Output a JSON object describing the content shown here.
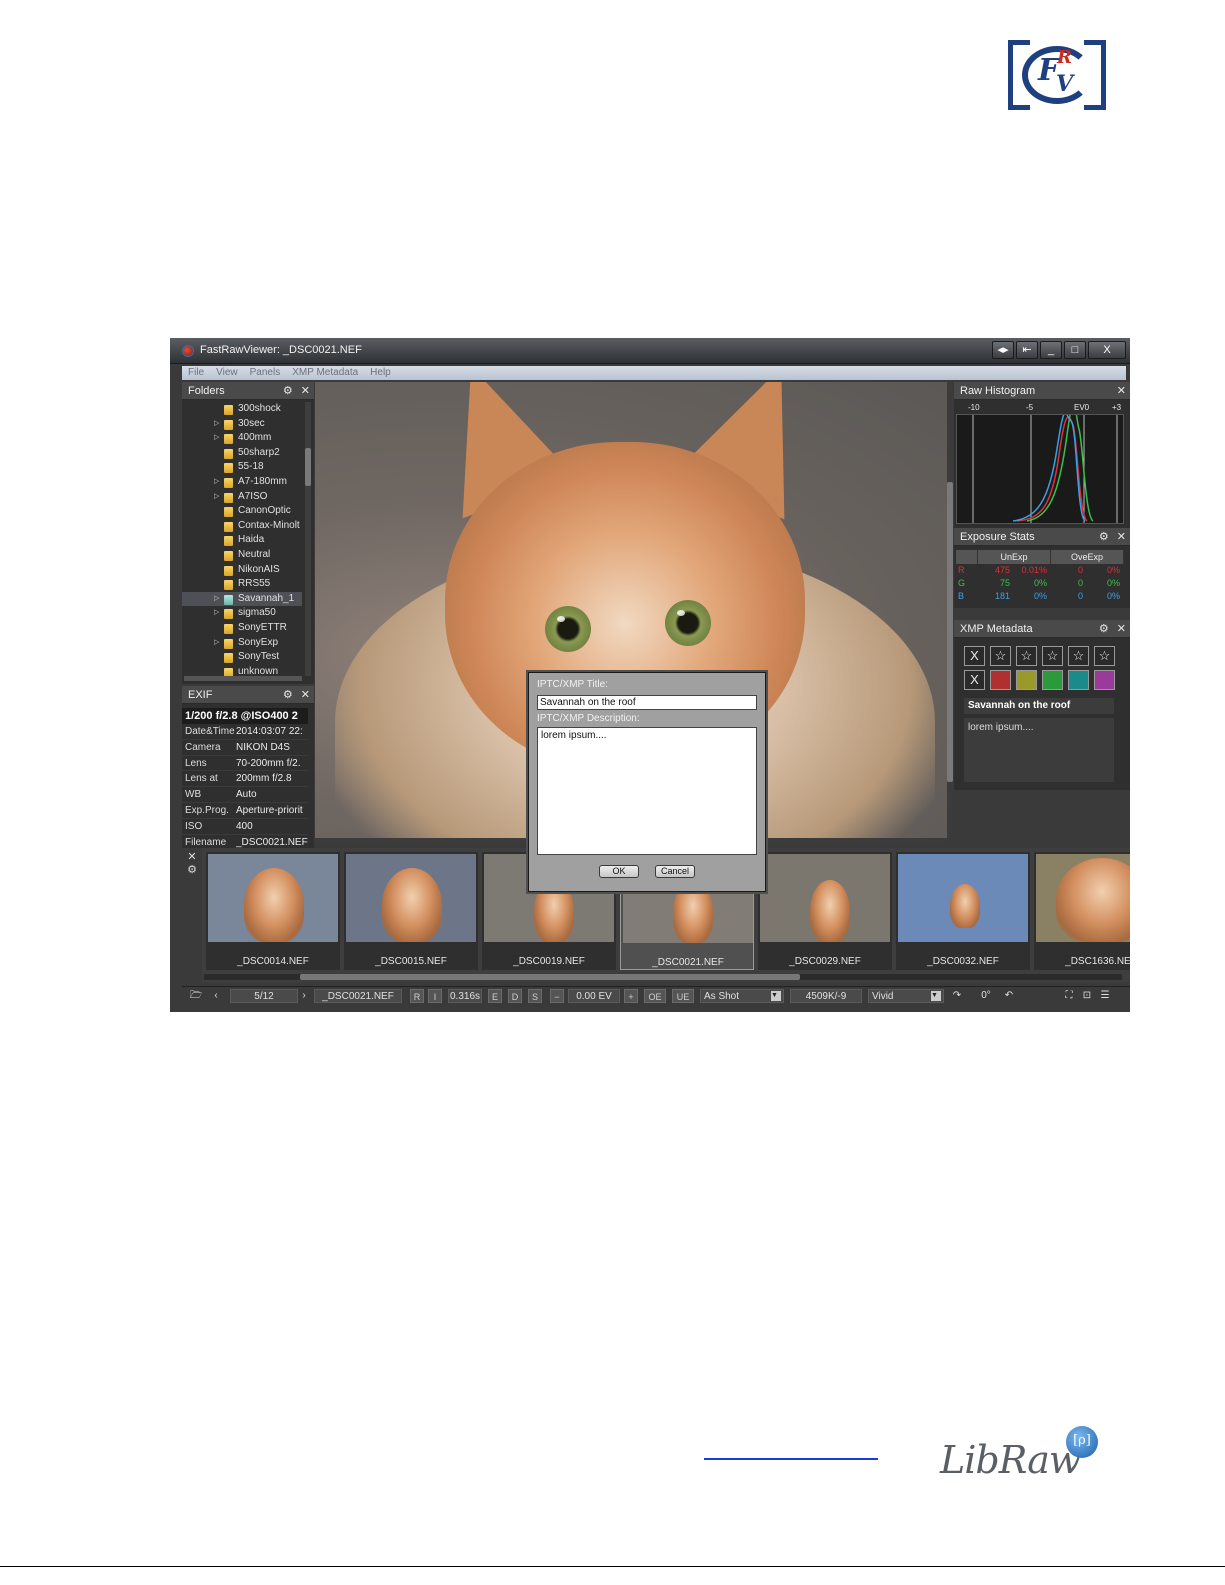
{
  "window": {
    "title": "FastRawViewer: _DSC0021.NEF",
    "buttons": [
      "◂▸",
      "⇤",
      "_",
      "□",
      "X"
    ]
  },
  "menu": [
    "File",
    "View",
    "Panels",
    "XMP Metadata",
    "Help"
  ],
  "folders": {
    "header": "Folders",
    "items": [
      {
        "label": "300shock",
        "expandable": false
      },
      {
        "label": "30sec",
        "expandable": true
      },
      {
        "label": "400mm",
        "expandable": true
      },
      {
        "label": "50sharp2",
        "expandable": false
      },
      {
        "label": "55-18",
        "expandable": false
      },
      {
        "label": "A7-180mm",
        "expandable": true
      },
      {
        "label": "A7ISO",
        "expandable": true
      },
      {
        "label": "CanonOptic",
        "expandable": false
      },
      {
        "label": "Contax-Minolt",
        "expandable": false
      },
      {
        "label": "Haida",
        "expandable": false
      },
      {
        "label": "Neutral",
        "expandable": false
      },
      {
        "label": "NikonAIS",
        "expandable": false
      },
      {
        "label": "RRS55",
        "expandable": false
      },
      {
        "label": "Savannah_1",
        "expandable": true,
        "selected": true
      },
      {
        "label": "sigma50",
        "expandable": true
      },
      {
        "label": "SonyETTR",
        "expandable": false
      },
      {
        "label": "SonyExp",
        "expandable": true
      },
      {
        "label": "SonyTest",
        "expandable": false
      },
      {
        "label": "unknown",
        "expandable": false
      }
    ]
  },
  "exif": {
    "header": "EXIF",
    "summary": "1/200 f/2.8 @ISO400 2",
    "rows": [
      {
        "k": "Date&Time",
        "v": "2014:03:07 22:"
      },
      {
        "k": "Camera",
        "v": "NIKON D4S"
      },
      {
        "k": "Lens",
        "v": "70-200mm f/2."
      },
      {
        "k": "Lens at",
        "v": "200mm f/2.8"
      },
      {
        "k": "WB",
        "v": "Auto"
      },
      {
        "k": "Exp.Prog.",
        "v": "Aperture-priorit"
      },
      {
        "k": "ISO",
        "v": "400"
      },
      {
        "k": "Filename",
        "v": "_DSC0021.NEF"
      }
    ]
  },
  "histogram": {
    "header": "Raw Histogram",
    "scale": [
      "-10",
      "-5",
      "EV0",
      "+3"
    ]
  },
  "exposure_stats": {
    "header": "Exposure Stats",
    "columns": [
      "UnExp",
      "OveExp"
    ],
    "rows": [
      {
        "ch": "R",
        "u1": "475",
        "u2": "0.01%",
        "o1": "0",
        "o2": "0%",
        "color": "#e0303a"
      },
      {
        "ch": "G",
        "u1": "75",
        "u2": "0%",
        "o1": "0",
        "o2": "0%",
        "color": "#3ac04a"
      },
      {
        "ch": "B",
        "u1": "181",
        "u2": "0%",
        "o1": "0",
        "o2": "0%",
        "color": "#3aa0e8"
      }
    ]
  },
  "xmp": {
    "header": "XMP Metadata",
    "reject": "X",
    "star": "☆",
    "colors": [
      "#b03030",
      "#9a9a2a",
      "#2a9a3a",
      "#1a8a8a",
      "#9a3a9a"
    ],
    "title": "Savannah on the roof",
    "description": "lorem ipsum...."
  },
  "dialog": {
    "title_label": "IPTC/XMP Title:",
    "title_value": "Savannah on the roof",
    "desc_label": "IPTC/XMP Description:",
    "desc_value": "lorem ipsum....",
    "ok": "OK",
    "cancel": "Cancel"
  },
  "filmstrip": {
    "close": "✕",
    "settings": "⚙",
    "thumbs": [
      {
        "name": "_DSC0014.NEF",
        "bg": "#7a8699"
      },
      {
        "name": "_DSC0015.NEF",
        "bg": "#6d7688"
      },
      {
        "name": "_DSC0019.NEF",
        "bg": "#7d7a73"
      },
      {
        "name": "_DSC0021.NEF",
        "bg": "#817c75",
        "selected": true
      },
      {
        "name": "_DSC0029.NEF",
        "bg": "#7b776f"
      },
      {
        "name": "_DSC0032.NEF",
        "bg": "#6b8ab8"
      },
      {
        "name": "_DSC1636.NEF",
        "bg": "#8a8064"
      }
    ]
  },
  "statusbar": {
    "counter": "5/12",
    "filename": "_DSC0021.NEF",
    "r": "R",
    "i": "I",
    "shutter": "0.316s",
    "e": "E",
    "d": "D",
    "s": "S",
    "ev": "0.00 EV",
    "oe": "OE",
    "ue": "UE",
    "wb": "As Shot",
    "temp": "4509K/-9",
    "style": "Vivid",
    "rotation": "0°"
  },
  "colors": {
    "frv_blue": "#1e3f80",
    "frv_red": "#cc2a1f",
    "link_blue": "#1a3bd8"
  },
  "libraw": {
    "word": "LibRaw",
    "badge": "[ρ]"
  }
}
